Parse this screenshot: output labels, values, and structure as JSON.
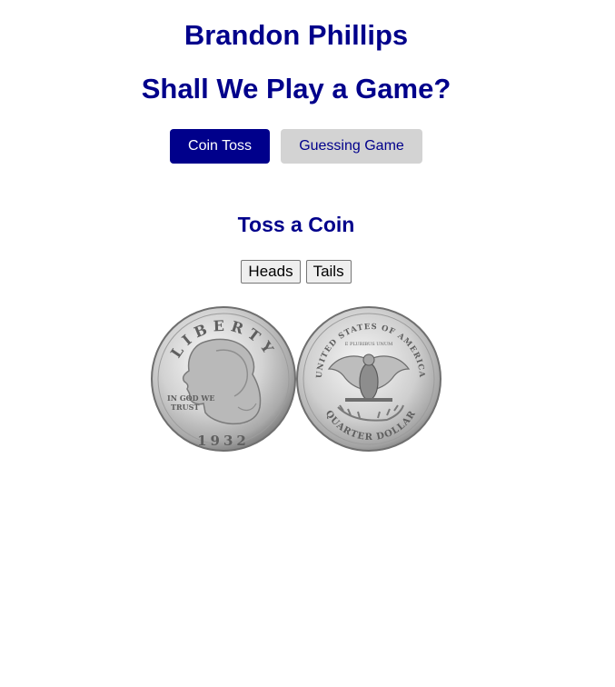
{
  "header": {
    "name": "Brandon Phillips",
    "title": "Shall We Play a Game?"
  },
  "tabs": [
    {
      "label": "Coin Toss",
      "active": true
    },
    {
      "label": "Guessing Game",
      "active": false
    }
  ],
  "coin_toss": {
    "title": "Toss a Coin",
    "heads_label": "Heads",
    "tails_label": "Tails",
    "coin_face_texts": {
      "obverse_top": "LIBERTY",
      "obverse_motto": "IN GOD WE TRUST",
      "obverse_year": "1932",
      "reverse_top": "UNITED STATES OF AMERICA",
      "reverse_motto": "E PLURIBUS UNUM",
      "reverse_bottom": "QUARTER DOLLAR"
    }
  },
  "colors": {
    "primary": "#00008b",
    "tab_inactive_bg": "#d3d3d3",
    "button_bg": "#efefef"
  }
}
